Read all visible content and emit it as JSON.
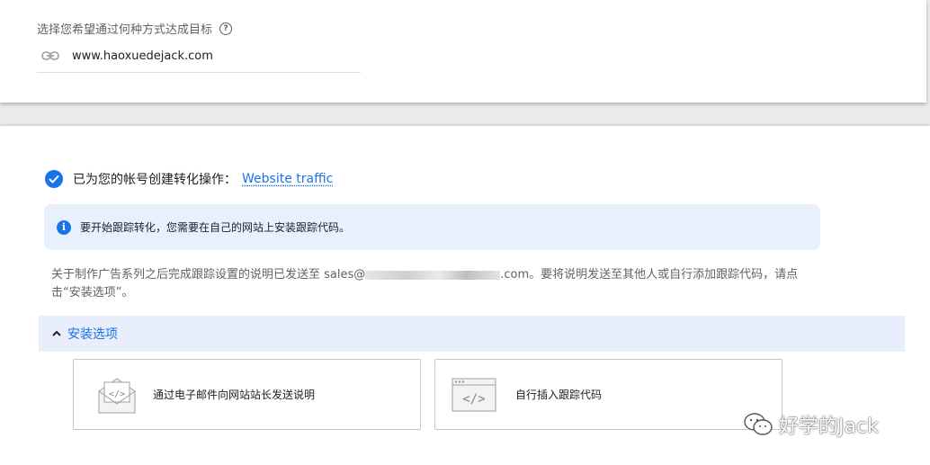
{
  "goal": {
    "label": "选择您希望通过何种方式达成目标",
    "help_icon": "?",
    "url_icon": "link-icon",
    "url": "www.haoxuedejack.com"
  },
  "conversion": {
    "created_text": "已为您的帐号创建转化操作：",
    "action_name": "Website traffic"
  },
  "info": {
    "icon": "i",
    "text": "要开始跟踪转化，您需要在自己的网站上安装跟踪代码。"
  },
  "description": {
    "before": "关于制作广告系列之后完成跟踪设置的说明已发送至 sales@",
    "after": ".com。要将说明发送至其他人或自行添加跟踪代码，请点击“安装选项”。"
  },
  "install": {
    "expander_label": "安装选项",
    "options": [
      {
        "label": "通过电子邮件向网站站长发送说明",
        "icon": "email-code-icon"
      },
      {
        "label": "自行插入跟踪代码",
        "icon": "browser-code-icon"
      }
    ]
  },
  "watermark": {
    "text": "好学的Jack",
    "icon": "wechat-icon"
  },
  "colors": {
    "accent": "#1a73e8",
    "info_bg": "#e8f0fe",
    "expander_bg": "#e8eefb"
  }
}
